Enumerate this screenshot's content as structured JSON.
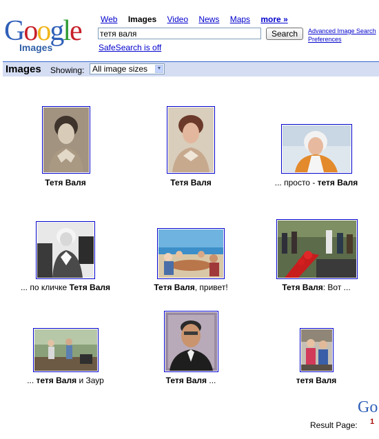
{
  "logo": {
    "letters": [
      "G",
      "o",
      "o",
      "g",
      "l",
      "e"
    ],
    "colors": [
      "#2f5fb8",
      "#c7202a",
      "#f1b51c",
      "#2f5fb8",
      "#2e9b32",
      "#c7202a"
    ],
    "sub": "Images"
  },
  "nav": {
    "web": "Web",
    "images": "Images",
    "video": "Video",
    "news": "News",
    "maps": "Maps",
    "more": "more »"
  },
  "search": {
    "query": "тетя валя",
    "button": "Search"
  },
  "links": {
    "advanced": "Advanced Image Search",
    "preferences": "Preferences",
    "safesearch": "SafeSearch is off"
  },
  "bar": {
    "title": "Images",
    "showing": "Showing:",
    "size_select": "All image sizes"
  },
  "results": [
    {
      "pre": "",
      "bold": "Тетя Валя",
      "post": "",
      "photo": "portrait-woman-sepia"
    },
    {
      "pre": "",
      "bold": "Тетя Валя",
      "post": "",
      "photo": "portrait-woman-color"
    },
    {
      "pre": "... просто - ",
      "bold": "тетя Валя",
      "post": "",
      "photo": "elderly-woman-white-hair"
    },
    {
      "pre": "... по кличке ",
      "bold": "Тетя Валя",
      "post": "",
      "photo": "woman-in-interior-bw"
    },
    {
      "pre": "",
      "bold": "Тетя Валя",
      "post": ", привет!",
      "photo": "group-at-beach-table"
    },
    {
      "pre": "",
      "bold": "Тетя Валя",
      "post": ": Вот ...",
      "photo": "memorial-with-flowers"
    },
    {
      "pre": "... ",
      "bold": "тетя Валя",
      "post": " и Заур",
      "photo": "people-outdoors"
    },
    {
      "pre": "",
      "bold": "Тетя Валя",
      "post": " ...",
      "photo": "man-portrait"
    },
    {
      "pre": "",
      "bold": "тетя Валя",
      "post": "",
      "photo": "two-children"
    }
  ],
  "footer": {
    "result_page": "Result Page:",
    "page": "1",
    "corner_logo": "Go"
  }
}
